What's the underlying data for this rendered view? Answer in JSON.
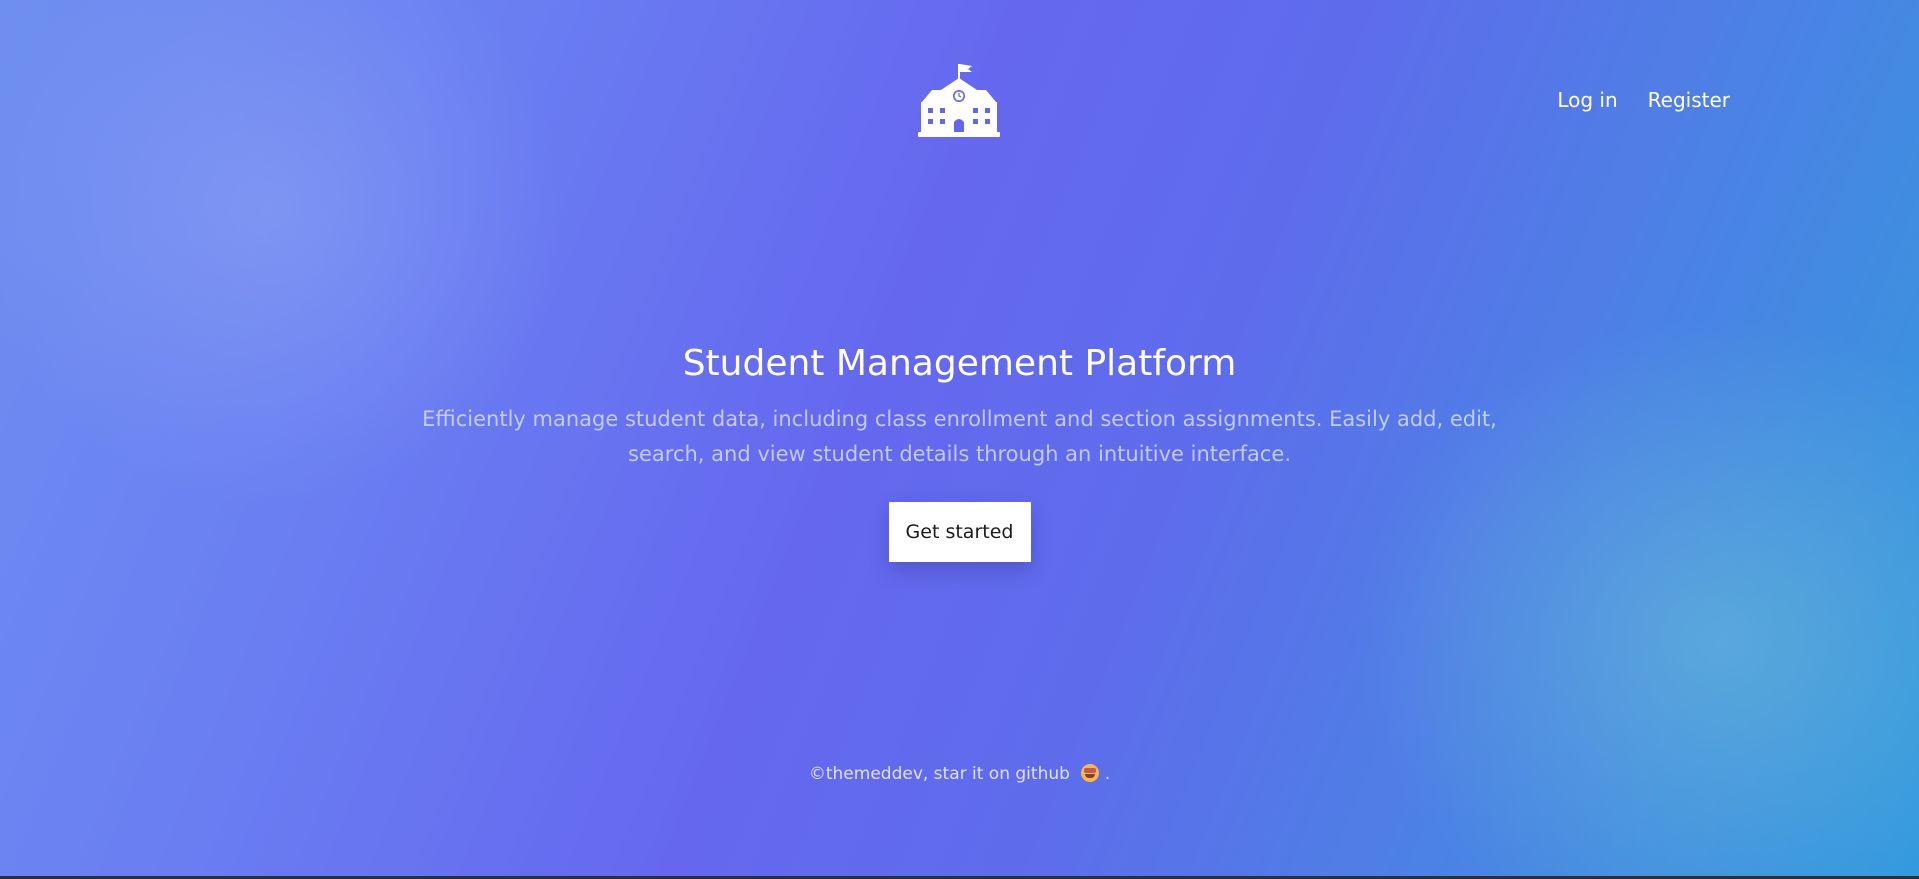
{
  "brand": {
    "logo_icon": "school-building-icon",
    "logo_color": "#ffffff"
  },
  "nav": {
    "login_label": "Log in",
    "register_label": "Register"
  },
  "hero": {
    "title": "Student Management Platform",
    "description": "Efficiently manage student data, including class enrollment and section assignments. Easily add, edit, search, and view student details through an intuitive interface.",
    "cta_label": "Get started"
  },
  "footer": {
    "text": "©themeddev, star it on github",
    "emoji_icon": "star-struck-emoji-icon",
    "suffix": "."
  },
  "colors": {
    "gradient_start": "#6f8ff0",
    "gradient_mid": "#6568ef",
    "gradient_end": "#2f98de",
    "button_bg": "#ffffff",
    "text": "#ffffff"
  }
}
